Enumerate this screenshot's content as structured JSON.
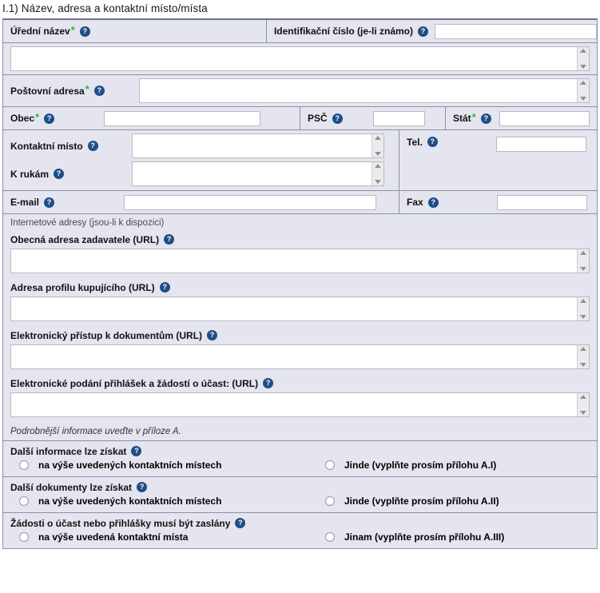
{
  "section": {
    "title": "I.1) Název, adresa a kontaktní místo/místa"
  },
  "icons": {
    "help": "?",
    "required_star": "*"
  },
  "colors": {
    "panel_bg": "#e4e5ef",
    "panel_border": "#8c8fa6",
    "help_icon": "#1f4e87",
    "required_star": "#2eb82e",
    "input_bg": "#ffffff"
  },
  "fields": {
    "official_name": {
      "label": "Úřední název",
      "required": true,
      "value": ""
    },
    "identification_number": {
      "label": "Identifikační číslo (je-li známo)",
      "required": false,
      "value": ""
    },
    "postal_address": {
      "label": "Poštovní adresa",
      "required": true,
      "value": ""
    },
    "city": {
      "label": "Obec",
      "required": true,
      "value": ""
    },
    "postal_code": {
      "label": "PSČ",
      "required": false,
      "value": ""
    },
    "state": {
      "label": "Stát",
      "required": true,
      "value": ""
    },
    "contact_point": {
      "label": "Kontaktní místo",
      "required": false,
      "value": ""
    },
    "attention_of": {
      "label": "K rukám",
      "required": false,
      "value": ""
    },
    "telephone": {
      "label": "Tel.",
      "required": false,
      "value": ""
    },
    "email": {
      "label": "E-mail",
      "required": false,
      "value": ""
    },
    "fax": {
      "label": "Fax",
      "required": false,
      "value": ""
    }
  },
  "internet": {
    "heading": "Internetové adresy (jsou-li k dispozici)",
    "urls": [
      {
        "label": "Obecná adresa zadavatele (URL)",
        "value": ""
      },
      {
        "label": "Adresa profilu kupujícího (URL)",
        "value": ""
      },
      {
        "label": "Elektronický přístup k dokumentům (URL)",
        "value": ""
      },
      {
        "label": "Elektronické podání přihlášek a žádostí o účast: (URL)",
        "value": ""
      }
    ],
    "footnote": "Podrobnější informace uveďte v příloze A."
  },
  "radio_groups": [
    {
      "label": "Další informace lze získat",
      "options": [
        {
          "label": "na výše uvedených kontaktních místech",
          "selected": false
        },
        {
          "label": "Jinde (vyplňte prosím přílohu A.I)",
          "selected": false
        }
      ]
    },
    {
      "label": "Další dokumenty lze získat",
      "options": [
        {
          "label": "na výše uvedených kontaktních místech",
          "selected": false
        },
        {
          "label": "Jinde (vyplňte prosím přílohu A.II)",
          "selected": false
        }
      ]
    },
    {
      "label": "Žádosti o účast nebo přihlášky musí být zaslány",
      "options": [
        {
          "label": "na výše uvedená kontaktní místa",
          "selected": false
        },
        {
          "label": "Jinam (vyplňte prosím přílohu A.III)",
          "selected": false
        }
      ]
    }
  ]
}
